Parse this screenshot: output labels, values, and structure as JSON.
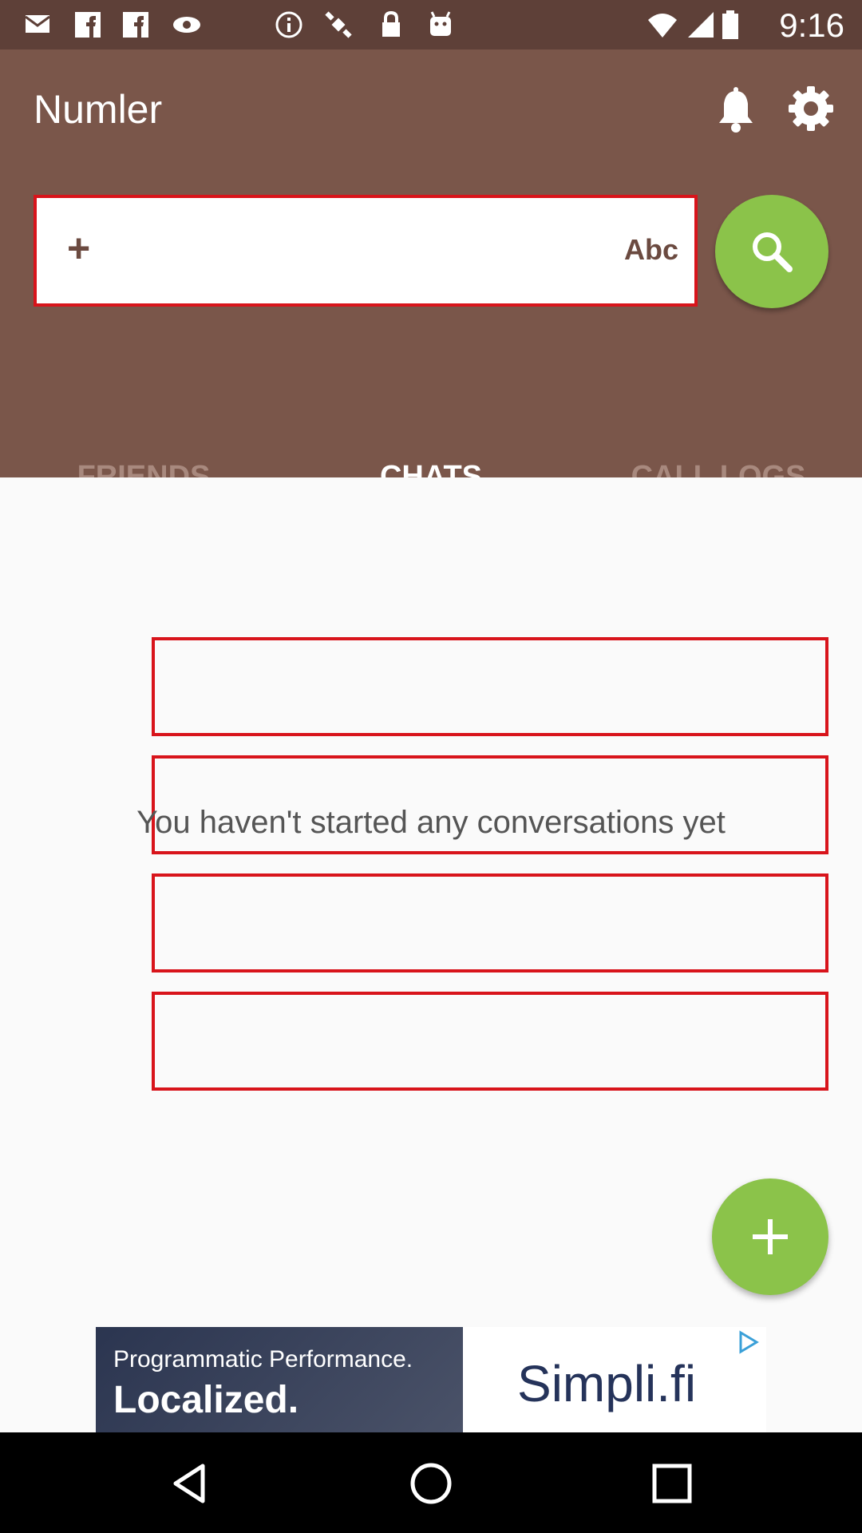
{
  "status_bar": {
    "time": "9:16"
  },
  "app_bar": {
    "title": "Numler"
  },
  "search": {
    "plus": "+",
    "mode_label": "Abc",
    "value": "",
    "placeholder": ""
  },
  "tabs": [
    {
      "label": "FRIENDS",
      "active": false
    },
    {
      "label": "CHATS",
      "active": true
    },
    {
      "label": "CALL LOGS",
      "active": false
    }
  ],
  "content": {
    "empty_message": "You haven't started any conversations yet"
  },
  "ad": {
    "line1": "Programmatic Performance.",
    "line2": "Localized.",
    "brand": "Simpli.fi"
  },
  "colors": {
    "primary": "#7a564a",
    "status_bar": "#5e4038",
    "accent": "#8bc34a",
    "highlight_border": "#d8141b"
  },
  "icons": [
    "email-icon",
    "facebook-icon",
    "facebook-icon",
    "eye-icon",
    "info-icon",
    "satellite-icon",
    "lock-icon",
    "android-icon",
    "wifi-icon",
    "signal-icon",
    "battery-icon",
    "bell-icon",
    "gear-icon",
    "search-icon",
    "add-icon",
    "back-icon",
    "home-icon",
    "recents-icon"
  ]
}
